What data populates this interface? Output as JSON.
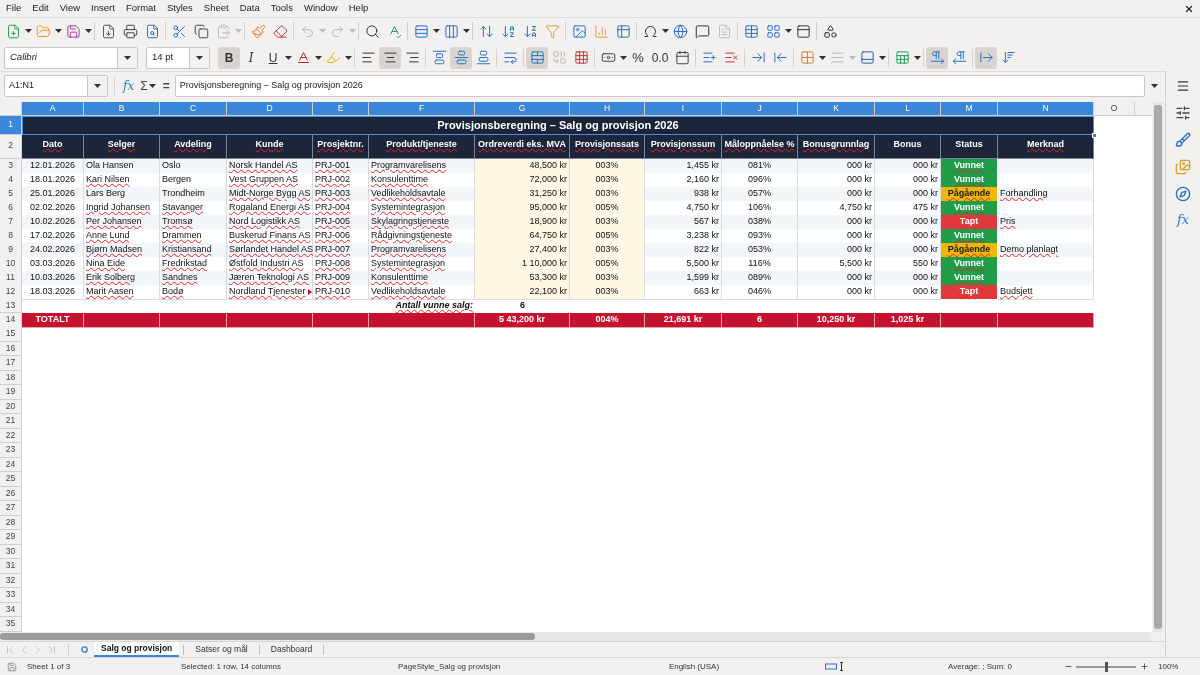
{
  "menu": [
    "File",
    "Edit",
    "View",
    "Insert",
    "Format",
    "Styles",
    "Sheet",
    "Data",
    "Tools",
    "Window",
    "Help"
  ],
  "standard_toolbar": {
    "paste_disabled": true,
    "undo_disabled": true,
    "redo_disabled": true,
    "headers_footers_disabled": true
  },
  "formatting_toolbar": {
    "font_name": "Calibri",
    "font_size": "14 pt",
    "bold": {
      "label": "B",
      "on": true
    },
    "italic": {
      "label": "I",
      "on": false
    },
    "underline": {
      "label": "U",
      "on": false
    },
    "horizontal_align": {
      "left": false,
      "center": true,
      "right": false
    },
    "vertical_align": {
      "top": false,
      "center": true,
      "bottom": false
    },
    "merge_and_center": true,
    "merge_cells_disabled": true,
    "percent_label": "%",
    "number_label": "0.0",
    "border_style_disabled": true,
    "paragraph_direction": {
      "left_to_right": true,
      "right_to_left": false
    },
    "text_direction": {
      "left_to_right": true,
      "top_to_bottom": false
    }
  },
  "formula_bar": {
    "name_box": "A1:N1",
    "function_wizard": "fx",
    "sum": "Σ",
    "formula": "=",
    "content": "Provisjonsberegning – Salg og provisjon 2026"
  },
  "columns": [
    {
      "label": "A",
      "selected": true
    },
    {
      "label": "B",
      "selected": true
    },
    {
      "label": "C",
      "selected": true
    },
    {
      "label": "D",
      "selected": true
    },
    {
      "label": "E",
      "selected": true
    },
    {
      "label": "F",
      "selected": true
    },
    {
      "label": "G",
      "selected": true
    },
    {
      "label": "H",
      "selected": true
    },
    {
      "label": "I",
      "selected": true
    },
    {
      "label": "J",
      "selected": true
    },
    {
      "label": "K",
      "selected": true
    },
    {
      "label": "L",
      "selected": true
    },
    {
      "label": "M",
      "selected": true
    },
    {
      "label": "N",
      "selected": true
    },
    {
      "label": "O",
      "selected": false
    }
  ],
  "row_headers": [
    {
      "label": "1",
      "selected": true
    },
    {
      "label": "2",
      "selected": false
    },
    {
      "label": "3",
      "selected": false
    },
    {
      "label": "4",
      "selected": false
    },
    {
      "label": "5",
      "selected": false
    },
    {
      "label": "6",
      "selected": false
    },
    {
      "label": "7",
      "selected": false
    },
    {
      "label": "8",
      "selected": false
    },
    {
      "label": "9",
      "selected": false
    },
    {
      "label": "10",
      "selected": false
    },
    {
      "label": "11",
      "selected": false
    },
    {
      "label": "12",
      "selected": false
    },
    {
      "label": "13",
      "selected": false
    },
    {
      "label": "14",
      "selected": false
    },
    {
      "label": "15",
      "selected": false
    },
    {
      "label": "16",
      "selected": false
    },
    {
      "label": "17",
      "selected": false
    },
    {
      "label": "18",
      "selected": false
    },
    {
      "label": "19",
      "selected": false
    },
    {
      "label": "20",
      "selected": false
    },
    {
      "label": "21",
      "selected": false
    },
    {
      "label": "22",
      "selected": false
    },
    {
      "label": "23",
      "selected": false
    },
    {
      "label": "24",
      "selected": false
    },
    {
      "label": "25",
      "selected": false
    },
    {
      "label": "26",
      "selected": false
    },
    {
      "label": "27",
      "selected": false
    },
    {
      "label": "28",
      "selected": false
    },
    {
      "label": "29",
      "selected": false
    },
    {
      "label": "30",
      "selected": false
    },
    {
      "label": "31",
      "selected": false
    },
    {
      "label": "32",
      "selected": false
    },
    {
      "label": "33",
      "selected": false
    },
    {
      "label": "34",
      "selected": false
    },
    {
      "label": "35",
      "selected": false
    }
  ],
  "table": {
    "title": "Provisjonsberegning – Salg og provisjon 2026",
    "headers": [
      {
        "text": "Dato",
        "misspelled": true
      },
      {
        "text": "Selger",
        "misspelled": true
      },
      {
        "text": "Avdeling",
        "misspelled": true
      },
      {
        "text": "Kunde",
        "misspelled": true
      },
      {
        "text": "Prosjektnr.",
        "misspelled": true
      },
      {
        "text": "Produkt/tjeneste",
        "misspelled": true
      },
      {
        "text": "Ordreverdi eks. MVA",
        "misspelled": true
      },
      {
        "text": "Provisjonssats",
        "misspelled": true
      },
      {
        "text": "Provisjonssum",
        "misspelled": true
      },
      {
        "text": "Måloppnåelse %",
        "misspelled": true
      },
      {
        "text": "Bonusgrunnlag",
        "misspelled": true
      },
      {
        "text": "Bonus",
        "misspelled": false
      },
      {
        "text": "Status",
        "misspelled": false
      },
      {
        "text": "Merknad",
        "misspelled": true
      }
    ],
    "rows": [
      {
        "date": "12.01.2026",
        "seller": {
          "text": "Ola Hansen",
          "misspelled": false
        },
        "department": {
          "text": "Oslo",
          "misspelled": false
        },
        "customer": {
          "text": "Norsk Handel AS",
          "misspelled": true,
          "clipped": false
        },
        "project": {
          "text": "PRJ-001",
          "misspelled": true
        },
        "product": {
          "text": "Programvarelisens",
          "misspelled": true
        },
        "order_value": "48,500 kr",
        "commission_rate": "003%",
        "commission_sum": "1,455 kr",
        "achievement": "081%",
        "bonus_base": "000 kr",
        "bonus": "000 kr",
        "status": {
          "text": "Vunnet",
          "color": "#1f9d48",
          "misspelled": true
        }
      },
      {
        "date": "18.01.2026",
        "seller": {
          "text": "Kari Nilsen",
          "misspelled": true
        },
        "department": {
          "text": "Bergen",
          "misspelled": false
        },
        "customer": {
          "text": "Vest Gruppen AS",
          "misspelled": true,
          "clipped": false
        },
        "project": {
          "text": "PRJ-002",
          "misspelled": true
        },
        "product": {
          "text": "Konsulenttime",
          "misspelled": true
        },
        "order_value": "72,000 kr",
        "commission_rate": "003%",
        "commission_sum": "2,160 kr",
        "achievement": "096%",
        "bonus_base": "000 kr",
        "bonus": "000 kr",
        "status": {
          "text": "Vunnet",
          "color": "#1f9d48",
          "misspelled": true
        }
      },
      {
        "date": "25.01.2026",
        "seller": {
          "text": "Lars Berg",
          "misspelled": false
        },
        "department": {
          "text": "Trondheim",
          "misspelled": false
        },
        "customer": {
          "text": "Midt-Norge Bygg AS",
          "misspelled": true,
          "clipped": false
        },
        "project": {
          "text": "PRJ-003",
          "misspelled": true
        },
        "product": {
          "text": "Vedlikeholdsavtale",
          "misspelled": true
        },
        "order_value": "31,250 kr",
        "commission_rate": "003%",
        "commission_sum": "938 kr",
        "achievement": "057%",
        "bonus_base": "000 kr",
        "bonus": "000 kr",
        "status": {
          "text": "Pågående",
          "color": "#f2b705",
          "misspelled": true
        },
        "note": {
          "text": "Forhandling",
          "misspelled": true
        }
      },
      {
        "date": "02.02.2026",
        "seller": {
          "text": "Ingrid Johansen",
          "misspelled": true
        },
        "department": {
          "text": "Stavanger",
          "misspelled": true
        },
        "customer": {
          "text": "Rogaland Energi AS",
          "misspelled": true,
          "clipped": false
        },
        "project": {
          "text": "PRJ-004",
          "misspelled": true
        },
        "product": {
          "text": "Systemintegrasjon",
          "misspelled": true
        },
        "order_value": "95,000 kr",
        "commission_rate": "005%",
        "commission_sum": "4,750 kr",
        "achievement": "106%",
        "bonus_base": "4,750 kr",
        "bonus": "475 kr",
        "status": {
          "text": "Vunnet",
          "color": "#1f9d48",
          "misspelled": true
        }
      },
      {
        "date": "10.02.2026",
        "seller": {
          "text": "Per Johansen",
          "misspelled": true
        },
        "department": {
          "text": "Tromsø",
          "misspelled": true
        },
        "customer": {
          "text": "Nord Logistikk AS",
          "misspelled": true,
          "clipped": false
        },
        "project": {
          "text": "PRJ-005",
          "misspelled": true
        },
        "product": {
          "text": "Skylagringstjeneste",
          "misspelled": true
        },
        "order_value": "18,900 kr",
        "commission_rate": "003%",
        "commission_sum": "567 kr",
        "achievement": "038%",
        "bonus_base": "000 kr",
        "bonus": "000 kr",
        "status": {
          "text": "Tapt",
          "color": "#e2383b",
          "misspelled": true
        },
        "note": {
          "text": "Pris",
          "misspelled": true
        }
      },
      {
        "date": "17.02.2026",
        "seller": {
          "text": "Anne Lund",
          "misspelled": true
        },
        "department": {
          "text": "Drammen",
          "misspelled": true
        },
        "customer": {
          "text": "Buskerud Finans AS",
          "misspelled": true,
          "clipped": false
        },
        "project": {
          "text": "PRJ-006",
          "misspelled": true
        },
        "product": {
          "text": "Rådgivningstjeneste",
          "misspelled": true
        },
        "order_value": "64,750 kr",
        "commission_rate": "005%",
        "commission_sum": "3,238 kr",
        "achievement": "093%",
        "bonus_base": "000 kr",
        "bonus": "000 kr",
        "status": {
          "text": "Vunnet",
          "color": "#1f9d48",
          "misspelled": true
        }
      },
      {
        "date": "24.02.2026",
        "seller": {
          "text": "Bjørn Madsen",
          "misspelled": true
        },
        "department": {
          "text": "Kristiansand",
          "misspelled": true
        },
        "customer": {
          "text": "Sørlandet Handel AS",
          "misspelled": true,
          "clipped": false
        },
        "project": {
          "text": "PRJ-007",
          "misspelled": true
        },
        "product": {
          "text": "Programvarelisens",
          "misspelled": true
        },
        "order_value": "27,400 kr",
        "commission_rate": "003%",
        "commission_sum": "822 kr",
        "achievement": "053%",
        "bonus_base": "000 kr",
        "bonus": "000 kr",
        "status": {
          "text": "Pågående",
          "color": "#f2b705",
          "misspelled": true
        },
        "note": {
          "text": "Demo planlagt",
          "misspelled": true
        }
      },
      {
        "date": "03.03.2026",
        "seller": {
          "text": "Nina Eide",
          "misspelled": true
        },
        "department": {
          "text": "Fredrikstad",
          "misspelled": true
        },
        "customer": {
          "text": "Østfold Industri AS",
          "misspelled": true,
          "clipped": false
        },
        "project": {
          "text": "PRJ-008",
          "misspelled": true
        },
        "product": {
          "text": "Systemintegrasjon",
          "misspelled": true
        },
        "order_value": "1 10,000 kr",
        "commission_rate": "005%",
        "commission_sum": "5,500 kr",
        "achievement": "116%",
        "bonus_base": "5,500 kr",
        "bonus": "550 kr",
        "status": {
          "text": "Vunnet",
          "color": "#1f9d48",
          "misspelled": true
        }
      },
      {
        "date": "10.03.2026",
        "seller": {
          "text": "Erik Solberg",
          "misspelled": true
        },
        "department": {
          "text": "Sandnes",
          "misspelled": true
        },
        "customer": {
          "text": "Jæren Teknologi AS",
          "misspelled": true,
          "clipped": false
        },
        "project": {
          "text": "PRJ-009",
          "misspelled": true
        },
        "product": {
          "text": "Konsulenttime",
          "misspelled": true
        },
        "order_value": "53,300 kr",
        "commission_rate": "003%",
        "commission_sum": "1,599 kr",
        "achievement": "089%",
        "bonus_base": "000 kr",
        "bonus": "000 kr",
        "status": {
          "text": "Vunnet",
          "color": "#1f9d48",
          "misspelled": true
        }
      },
      {
        "date": "18.03.2026",
        "seller": {
          "text": "Marit Aasen",
          "misspelled": true
        },
        "department": {
          "text": "Bodø",
          "misspelled": true
        },
        "customer": {
          "text": "Nordland Tjenester",
          "misspelled": true,
          "clipped": true
        },
        "project": {
          "text": "PRJ-010",
          "misspelled": true
        },
        "product": {
          "text": "Vedlikeholdsavtale",
          "misspelled": true
        },
        "order_value": "22,100 kr",
        "commission_rate": "003%",
        "commission_sum": "663 kr",
        "achievement": "046%",
        "bonus_base": "000 kr",
        "bonus": "000 kr",
        "status": {
          "text": "Tapt",
          "color": "#e2383b",
          "misspelled": true
        },
        "note": {
          "text": "Budsjett",
          "misspelled": true
        }
      }
    ],
    "count_row": {
      "label": {
        "text": "Antall vunne salg:",
        "misspelled": true
      },
      "value": "6"
    },
    "total_row": {
      "label": "TOTALT",
      "order_value": "5 43,200 kr",
      "commission_rate": "004%",
      "commission_sum": "21,691 kr",
      "achievement": "6",
      "bonus_base": "10,250 kr",
      "bonus": "1,025 kr"
    }
  },
  "sheet_tabs": [
    {
      "label": "Salg og provisjon",
      "selected": true
    },
    {
      "label": "Satser og mål",
      "selected": false
    },
    {
      "label": "Dashboard",
      "selected": false
    }
  ],
  "status_bar": {
    "sheet": "Sheet 1 of 3",
    "selection": "Selected: 1 row, 14 columns",
    "page_style": "PageStyle_Salg og provisjon",
    "language": "English (USA)",
    "summary": "Average: ; Sum: 0",
    "zoom_slider": {
      "level": 0.5
    },
    "zoom": "100%"
  },
  "sidebar": {
    "functions_label": "fx"
  }
}
